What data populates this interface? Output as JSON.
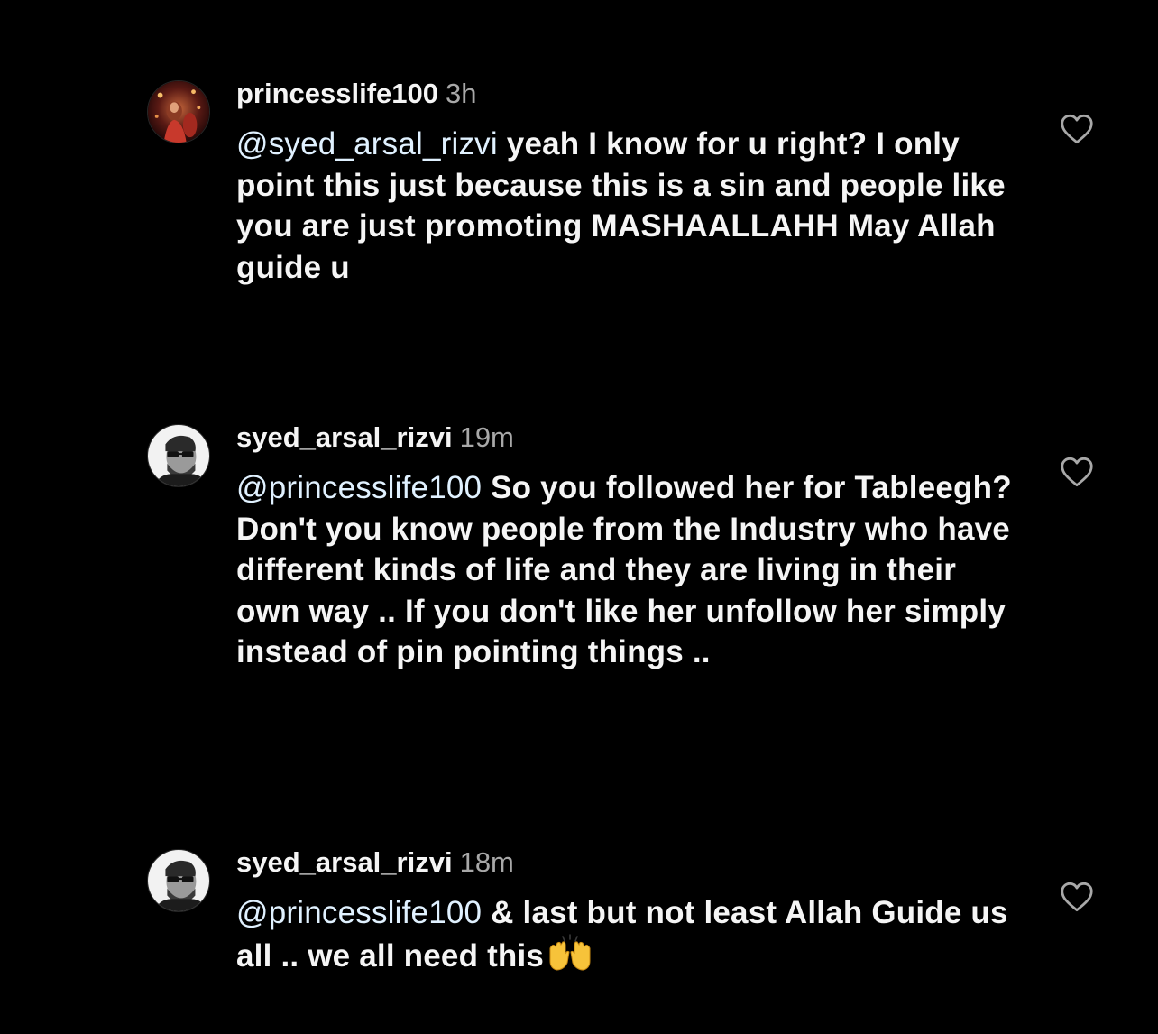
{
  "comments": [
    {
      "username": "princesslife100",
      "time": "3h",
      "mention": "@syed_arsal_rizvi",
      "text": " yeah I know for u right? I only point this just because this is a sin and people like you are just promoting MASHAALLAHH May Allah guide u",
      "avatar_icon": "profile-photo-red-lights",
      "like_icon": "heart-outline-icon"
    },
    {
      "username": "syed_arsal_rizvi",
      "time": "19m",
      "mention": "@princesslife100",
      "text": " So you followed her for Tableegh? Don't you know people from the Industry who have different kinds of life and they are living in their own way .. If you don't like her unfollow her simply instead of pin pointing things ..",
      "avatar_icon": "profile-photo-man-glasses",
      "like_icon": "heart-outline-icon"
    },
    {
      "username": "syed_arsal_rizvi",
      "time": "18m",
      "mention": "@princesslife100",
      "text": " & last but not least Allah Guide us all .. we all need this",
      "emoji": "🙌",
      "avatar_icon": "profile-photo-man-glasses",
      "like_icon": "heart-outline-icon"
    }
  ],
  "colors": {
    "background": "#000000",
    "text": "#f5f5f5",
    "mention": "#e0f1ff",
    "timestamp": "#a8a8a8"
  }
}
